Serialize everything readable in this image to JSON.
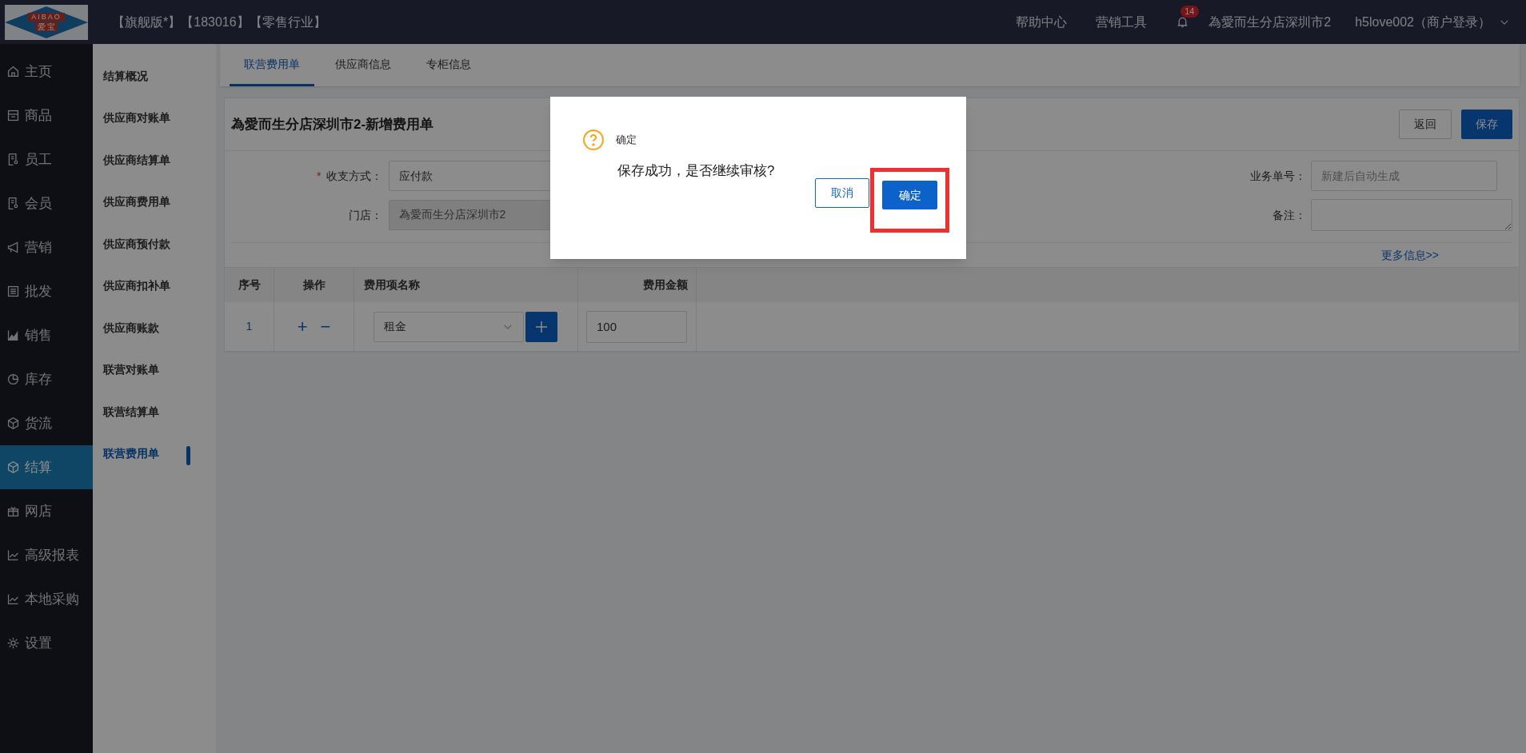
{
  "logo": {
    "text": "AIBAO",
    "subtext": "爱 宝"
  },
  "header": {
    "edition": "【旗舰版*】【183016】【零售行业】",
    "links": [
      "帮助中心",
      "营销工具"
    ],
    "notification_count": "14",
    "store": "為愛而生分店深圳市2",
    "user": "h5love002（商户登录）"
  },
  "sidebar": {
    "items": [
      {
        "label": "主页",
        "selected": false
      },
      {
        "label": "商品",
        "selected": false
      },
      {
        "label": "员工",
        "selected": false
      },
      {
        "label": "会员",
        "selected": false
      },
      {
        "label": "营销",
        "selected": false
      },
      {
        "label": "批发",
        "selected": false
      },
      {
        "label": "销售",
        "selected": false
      },
      {
        "label": "库存",
        "selected": false
      },
      {
        "label": "货流",
        "selected": false
      },
      {
        "label": "结算",
        "selected": true
      },
      {
        "label": "网店",
        "selected": false
      },
      {
        "label": "高级报表",
        "selected": false
      },
      {
        "label": "本地采购",
        "selected": false
      },
      {
        "label": "设置",
        "selected": false
      }
    ]
  },
  "submenu": {
    "items": [
      {
        "label": "结算概况",
        "selected": false
      },
      {
        "label": "供应商对账单",
        "selected": false
      },
      {
        "label": "供应商结算单",
        "selected": false
      },
      {
        "label": "供应商费用单",
        "selected": false
      },
      {
        "label": "供应商预付款",
        "selected": false
      },
      {
        "label": "供应商扣补单",
        "selected": false
      },
      {
        "label": "供应商账款",
        "selected": false
      },
      {
        "label": "联营对账单",
        "selected": false
      },
      {
        "label": "联营结算单",
        "selected": false
      },
      {
        "label": "联营费用单",
        "selected": true
      }
    ]
  },
  "tabs": [
    {
      "label": "联营费用单",
      "selected": true
    },
    {
      "label": "供应商信息",
      "selected": false
    },
    {
      "label": "专柜信息",
      "selected": false
    }
  ],
  "form": {
    "title": "為愛而生分店深圳市2-新增费用单",
    "buttons": [
      "返回",
      "保存"
    ],
    "fields": [
      {
        "label": "收支方式：",
        "required_mark": "*",
        "kind": "select",
        "value": "应付款"
      },
      {
        "label": "门店：",
        "kind": "text",
        "value": "為愛而生分店深圳市2",
        "disabled": true
      }
    ],
    "right_fields": [
      {
        "label": "业务单号：",
        "kind": "text",
        "placeholder": "新建后自动生成"
      },
      {
        "label": "备注：",
        "kind": "textarea"
      }
    ],
    "more_link": "更多信息>>"
  },
  "table": {
    "columns": [
      "序号",
      "操作",
      "费用项名称",
      "费用金额"
    ],
    "rows": [
      {
        "index": "1",
        "add": "+",
        "remove": "−",
        "item": "租金",
        "amount": "100"
      }
    ]
  },
  "dialog": {
    "title": "确定",
    "message": "保存成功，是否继续审核?",
    "buttons": [
      "取消",
      "确定"
    ]
  }
}
